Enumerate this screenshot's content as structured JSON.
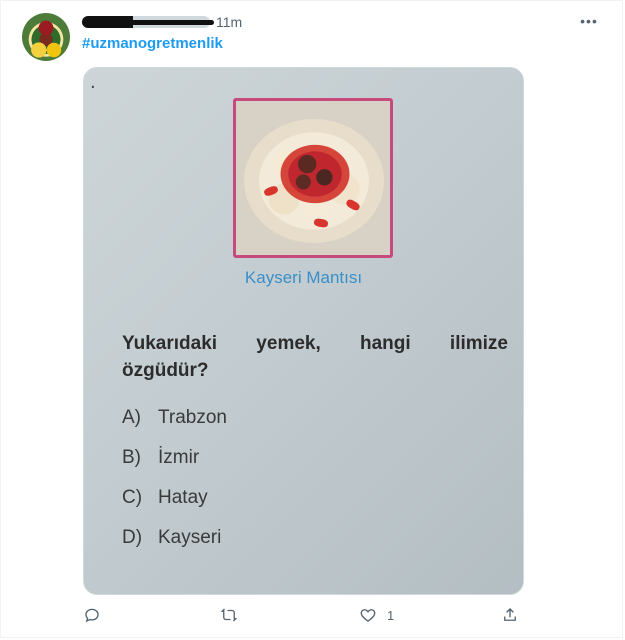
{
  "tweet": {
    "time": "11m",
    "hashtag": "#uzmanogretmenlik",
    "more_label": "•••"
  },
  "media": {
    "corner_mark": ".",
    "caption": "Kayseri Mantısı",
    "question_line1": "Yukarıdaki yemek, hangi ilimize",
    "question_line2": "özgüdür?",
    "options": [
      {
        "letter": "A)",
        "text": "Trabzon"
      },
      {
        "letter": "B)",
        "text": "İzmir"
      },
      {
        "letter": "C)",
        "text": "Hatay"
      },
      {
        "letter": "D)",
        "text": "Kayseri"
      }
    ]
  },
  "actions": {
    "reply_count": "",
    "retweet_count": "",
    "like_count": "1",
    "share_count": ""
  },
  "icons": [
    "avatar",
    "more-icon",
    "reply-icon",
    "retweet-icon",
    "like-icon",
    "share-icon"
  ],
  "colors": {
    "accent": "#1d9bf0",
    "muted": "#536471",
    "caption": "#3a8fc7",
    "frame": "#c74a7d"
  }
}
